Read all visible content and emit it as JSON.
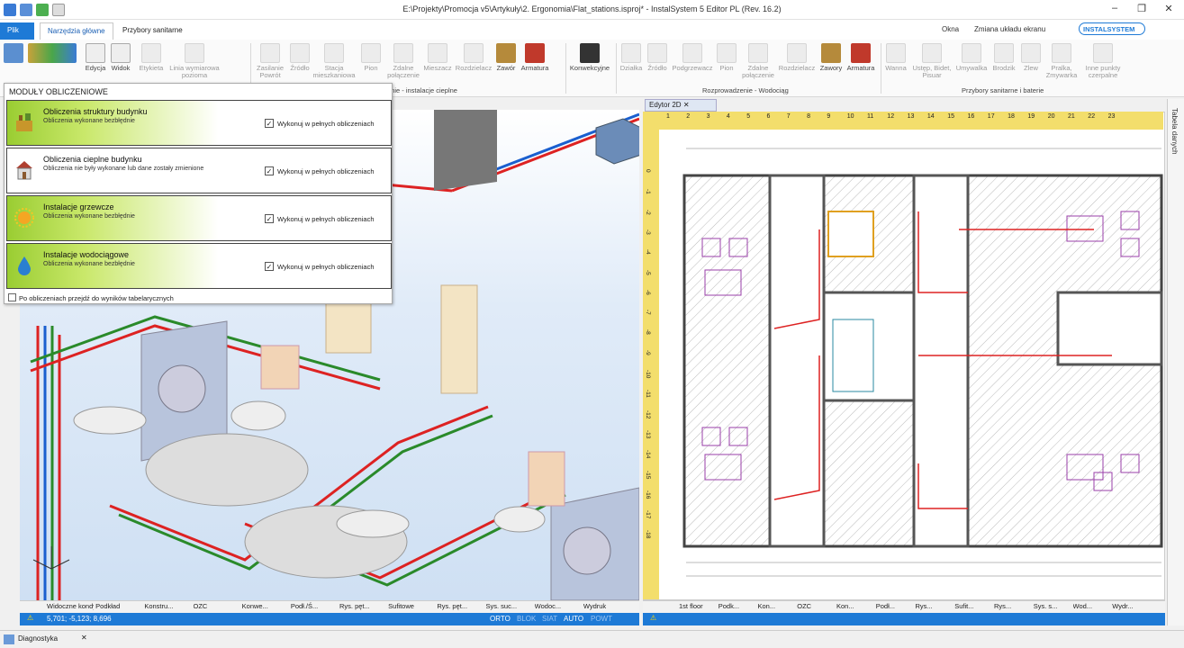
{
  "window": {
    "title": "E:\\Projekty\\Promocja v5\\Artykuły\\2. Ergonomia\\Flat_stations.isproj* - InstalSystem 5 Editor PL (Rev. 16.2)",
    "controls": [
      "–",
      "❐",
      "✕"
    ]
  },
  "menu": {
    "file": "Plik",
    "tabs": [
      "Narzędzia główne",
      "Przybory sanitarne"
    ],
    "right": [
      "Okna",
      "Zmiana układu ekranu"
    ],
    "brand": "INSTALSYSTEM"
  },
  "ribbon": {
    "buttons_a": [
      "Edycja",
      "Widok",
      "Etykieta",
      "Linia wymiarowa pozioma"
    ],
    "buttons_b": [
      "Zasilanie Powrót",
      "Źródło",
      "Stacja mieszkaniowa",
      "Pion",
      "Zdalne połączenie",
      "Mieszacz",
      "Rozdzielacz",
      "Zawór",
      "Armatura"
    ],
    "buttons_c": [
      "Konwekcyjne"
    ],
    "buttons_d": [
      "Działka",
      "Źródło",
      "Podgrzewacz",
      "Pion",
      "Zdalne połączenie",
      "Rozdzielacz",
      "Zawory",
      "Armatura"
    ],
    "buttons_e": [
      "Wanna",
      "Ustęp, Bidet, Pisuar",
      "Umywalka",
      "Brodzik",
      "Zlew",
      "Pralka, Zmywarka",
      "Inne punkty czerpalne"
    ],
    "groups": [
      "enie - instalacje cieplne",
      "Rozprowadzenie - Wodociąg",
      "Przybory sanitarne i baterie"
    ]
  },
  "popup": {
    "header": "MODUŁY OBLICZENIOWE",
    "modules": [
      {
        "title": "Obliczenia struktury budynku",
        "subtitle": "Obliczenia wykonane bezbłędnie",
        "checkbox_label": "Wykonuj w pełnych obliczeniach",
        "checked": true,
        "icon": "building-structure-icon",
        "color": "#9acd32"
      },
      {
        "title": "Obliczenia cieplne budynku",
        "subtitle": "Obliczenia nie były wykonane lub dane zostały zmienione",
        "checkbox_label": "Wykonuj w pełnych obliczeniach",
        "checked": true,
        "icon": "house-heat-icon",
        "color": "#ffffff"
      },
      {
        "title": "Instalacje grzewcze",
        "subtitle": "Obliczenia wykonane bezbłędnie",
        "checkbox_label": "Wykonuj w pełnych obliczeniach",
        "checked": true,
        "icon": "sun-heating-icon",
        "color": "#9acd32"
      },
      {
        "title": "Instalacje wodociągowe",
        "subtitle": "Obliczenia wykonane bezbłędnie",
        "checkbox_label": "Wykonuj w pełnych obliczeniach",
        "checked": true,
        "icon": "water-drop-icon",
        "color": "#9acd32"
      }
    ],
    "footer": "Po obliczeniach przejdź do wyników tabelarycznych"
  },
  "editor2d": {
    "tab": "Edytor 2D",
    "ruler_top": [
      "1",
      "2",
      "3",
      "4",
      "5",
      "6",
      "7",
      "8",
      "9",
      "10",
      "11",
      "12",
      "13",
      "14",
      "15",
      "16",
      "17",
      "18",
      "19",
      "20",
      "21",
      "22",
      "23"
    ],
    "ruler_left": [
      "0",
      "-1",
      "-2",
      "-3",
      "-4",
      "-5",
      "-6",
      "-7",
      "-8",
      "-9",
      "-10",
      "-11",
      "-12",
      "-13",
      "-14",
      "-15",
      "-16",
      "-17",
      "-18"
    ],
    "bottom_tabs": [
      "1st floor",
      "Podk...",
      "Kon...",
      "OZC",
      "Kon...",
      "Podł...",
      "Rys...",
      "Sufit...",
      "Rys...",
      "Sys. s...",
      "Wod...",
      "Wydr..."
    ]
  },
  "view3d": {
    "bottom_tabs": [
      "Widoczne kondygnacje",
      "Podkład",
      "Konstru...",
      "OZC",
      "Konwe...",
      "Podł./Ś...",
      "Rys. pęt...",
      "Sufitowe",
      "Rys. pęt...",
      "Sys. suc...",
      "Wodoc...",
      "Wydruk"
    ],
    "status_coords": "5,701; -5,123; 8,696",
    "status_modes": [
      "ORTO",
      "BLOK",
      "SIAT",
      "AUTO",
      "POWT"
    ]
  },
  "sidepanel": {
    "label": "Tabela danych"
  },
  "bottom": {
    "diag": "Diagnostyka"
  }
}
